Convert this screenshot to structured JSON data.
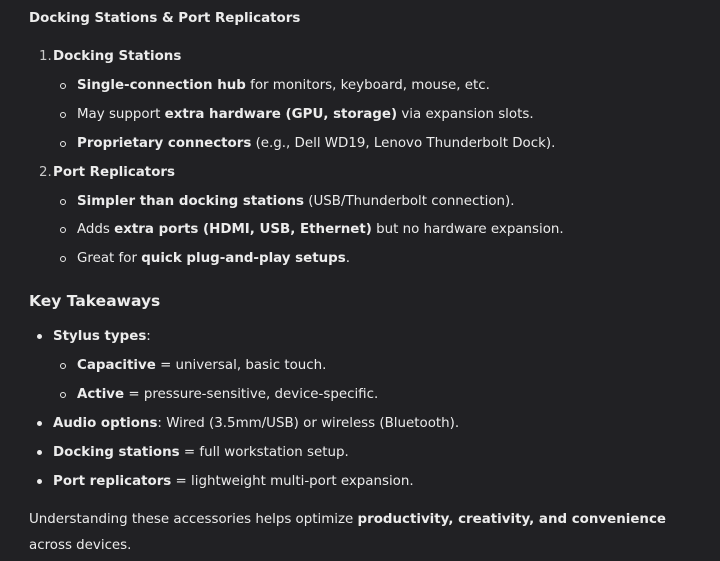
{
  "section_docking": {
    "title": "Docking Stations & Port Replicators",
    "items": [
      {
        "number": "1.",
        "title": "Docking Stations",
        "bullets": [
          {
            "bold": "Single-connection hub",
            "rest": " for monitors, keyboard, mouse, etc."
          },
          {
            "pre": "May support ",
            "bold": "extra hardware (GPU, storage)",
            "rest": " via expansion slots."
          },
          {
            "bold": "Proprietary connectors",
            "rest": " (e.g., Dell WD19, Lenovo Thunderbolt Dock)."
          }
        ]
      },
      {
        "number": "2.",
        "title": "Port Replicators",
        "bullets": [
          {
            "bold": "Simpler than docking stations",
            "rest": " (USB/Thunderbolt connection)."
          },
          {
            "pre": "Adds ",
            "bold": "extra ports (HDMI, USB, Ethernet)",
            "rest": " but no hardware expansion."
          },
          {
            "pre": "Great for ",
            "bold": "quick plug-and-play setups",
            "rest": "."
          }
        ]
      }
    ]
  },
  "takeaways": {
    "title": "Key Takeaways",
    "stylus": {
      "bold": "Stylus types",
      "rest": ":",
      "sub": [
        {
          "bold": "Capacitive",
          "rest": " = universal, basic touch."
        },
        {
          "bold": "Active",
          "rest": " = pressure-sensitive, device-specific."
        }
      ]
    },
    "items": [
      {
        "bold": "Audio options",
        "rest": ": Wired (3.5mm/USB) or wireless (Bluetooth)."
      },
      {
        "bold": "Docking stations",
        "rest": " = full workstation setup."
      },
      {
        "bold": "Port replicators",
        "rest": " = lightweight multi-port expansion."
      }
    ]
  },
  "conclusion": {
    "pre": "Understanding these accessories helps optimize ",
    "bold": "productivity, creativity, and convenience",
    "rest": " across devices."
  }
}
